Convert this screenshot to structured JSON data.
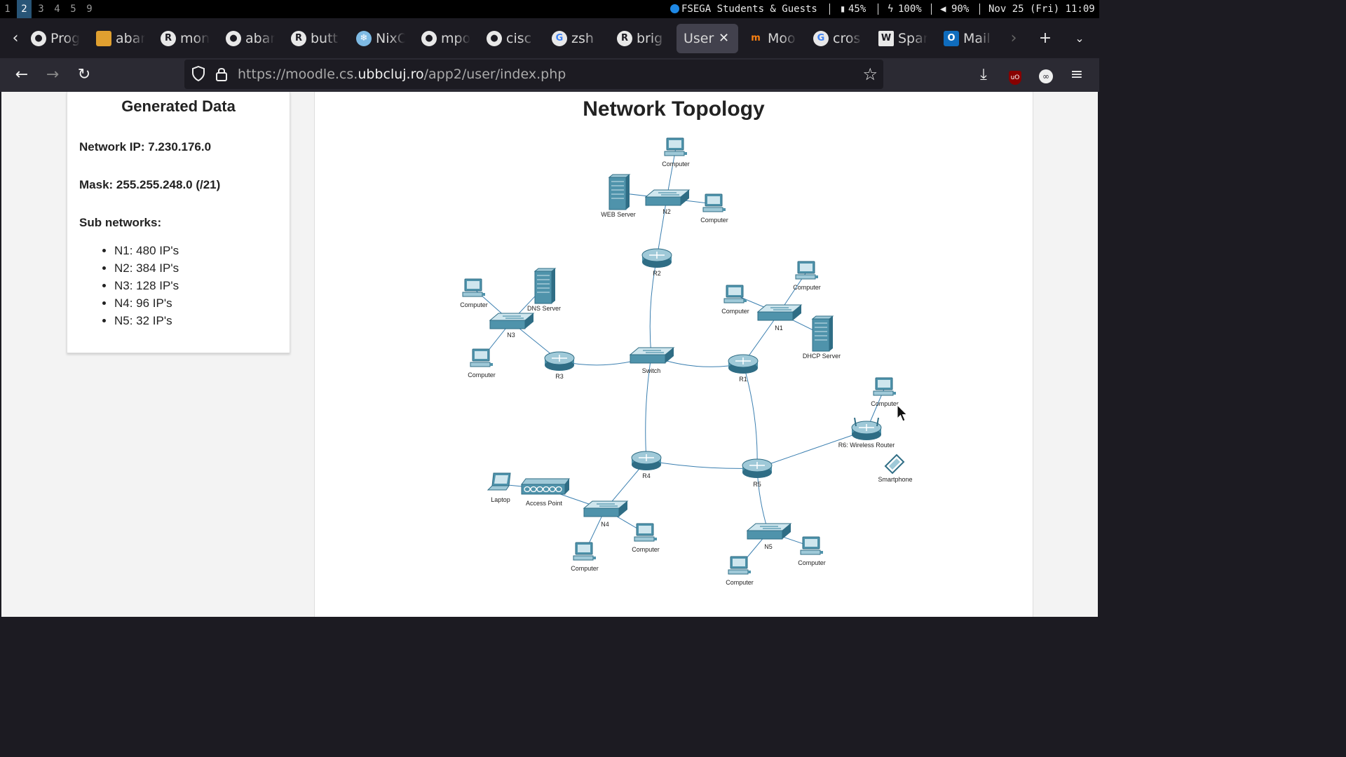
{
  "system_bar": {
    "workspaces": [
      "1",
      "2",
      "3",
      "4",
      "5",
      "9"
    ],
    "active_workspace": "2",
    "network": "FSEGA Students & Guests",
    "battery_1": "45%",
    "battery_2": "100%",
    "volume": "90%",
    "datetime": "Nov 25 (Fri) 11:09"
  },
  "tabs": [
    {
      "label": "Prog",
      "icon": "github-icon"
    },
    {
      "label": "abar",
      "icon": "package-icon"
    },
    {
      "label": "mon",
      "icon": "rust-icon"
    },
    {
      "label": "abar",
      "icon": "github-icon"
    },
    {
      "label": "butt",
      "icon": "rust-icon"
    },
    {
      "label": "NixO",
      "icon": "nixos-icon"
    },
    {
      "label": "mpo",
      "icon": "github-icon"
    },
    {
      "label": "cisc",
      "icon": "github-icon"
    },
    {
      "label": "zsh",
      "icon": "google-icon"
    },
    {
      "label": "brig",
      "icon": "rust-icon"
    },
    {
      "label": "User",
      "icon": "",
      "active": true
    },
    {
      "label": "Moo",
      "icon": "moodle-icon"
    },
    {
      "label": "cros",
      "icon": "google-icon"
    },
    {
      "label": "Spar",
      "icon": "wikipedia-icon"
    },
    {
      "label": "Mail",
      "icon": "outlook-icon"
    }
  ],
  "url": {
    "prefix": "https://moodle.cs.",
    "domain": "ubbcluj.ro",
    "path": "/app2/user/index.php"
  },
  "generated_data": {
    "title": "Generated Data",
    "network_ip": "Network IP: 7.230.176.0",
    "mask": "Mask: 255.255.248.0 (/21)",
    "subnetworks_heading": "Sub networks:",
    "subnetworks": [
      "N1: 480 IP's",
      "N2: 384 IP's",
      "N3: 128 IP's",
      "N4: 96 IP's",
      "N5: 32 IP's"
    ]
  },
  "topology": {
    "title": "Network Topology",
    "node_labels": {
      "n2_top_pc": "Computer",
      "web_server": "WEB Server",
      "n2": "N2",
      "n2_right_pc": "Computer",
      "r2": "R2",
      "n3_pc": "Computer",
      "dns_server": "DNS Server",
      "n3": "N3",
      "n3_bottom_pc": "Computer",
      "r3": "R3",
      "switch": "Switch",
      "n1_top_pc": "Computer",
      "n1_left_pc": "Computer",
      "n1": "N1",
      "dhcp_server": "DHCP Server",
      "r1": "R1",
      "r6_pc": "Computer",
      "r6": "R6: Wireless Router",
      "smartphone": "Smartphone",
      "r4": "R4",
      "r5": "R5",
      "laptop": "Laptop",
      "access_point": "Access Point",
      "n4": "N4",
      "n4_right_pc": "Computer",
      "n4_bottom_pc": "Computer",
      "n5": "N5",
      "n5_right_pc": "Computer",
      "n5_bottom_pc": "Computer"
    }
  },
  "colors": {
    "device": "#4a8fa8",
    "link": "#3b7fb0",
    "active_workspace": "#285577"
  }
}
